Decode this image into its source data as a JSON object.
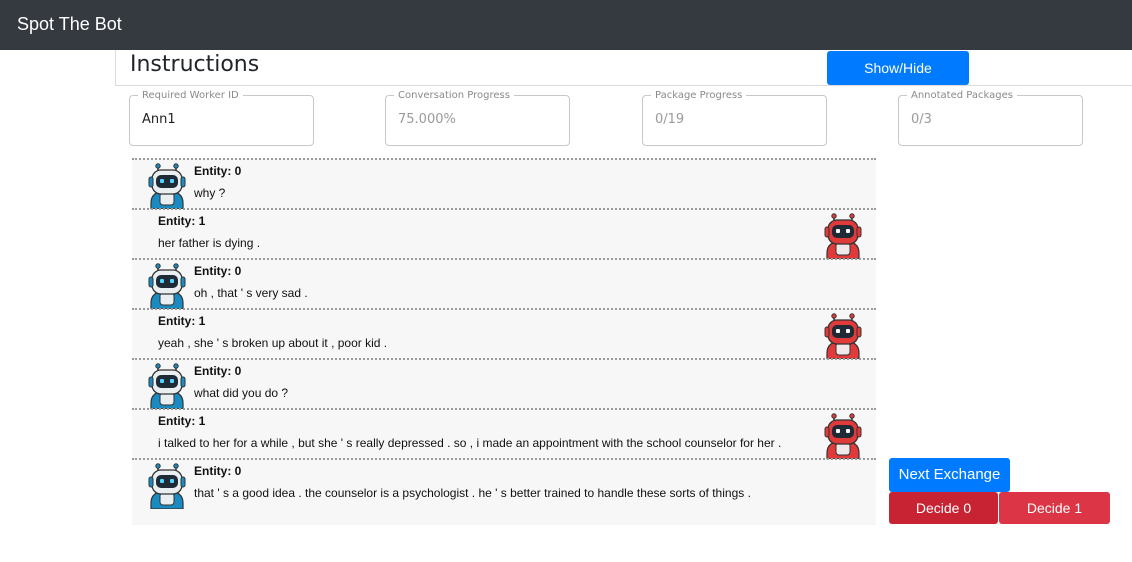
{
  "navbar": {
    "brand": "Spot The Bot"
  },
  "instructions": {
    "title": "Instructions",
    "toggle_label": "Show/Hide"
  },
  "fields": [
    {
      "label": "Required Worker ID",
      "value": "Ann1"
    },
    {
      "label": "Conversation Progress",
      "value": "75.000%"
    },
    {
      "label": "Package Progress",
      "value": "0/19"
    },
    {
      "label": "Annotated Packages",
      "value": "0/3"
    }
  ],
  "messages": [
    {
      "entity": "Entity: 0",
      "text": "why ?"
    },
    {
      "entity": "Entity: 1",
      "text": "her father is dying ."
    },
    {
      "entity": "Entity: 0",
      "text": "oh , that ' s very sad ."
    },
    {
      "entity": "Entity: 1",
      "text": "yeah , she ' s broken up about it , poor kid ."
    },
    {
      "entity": "Entity: 0",
      "text": "what did you do ?"
    },
    {
      "entity": "Entity: 1",
      "text": "i talked to her for a while , but she ' s really depressed . so , i made an appointment with the school counselor for her ."
    },
    {
      "entity": "Entity: 0",
      "text": "that ' s a good idea . the counselor is a psychologist . he ' s better trained to handle these sorts of things ."
    }
  ],
  "actions": {
    "next_label": "Next Exchange",
    "decide0_label": "Decide 0",
    "decide1_label": "Decide 1"
  },
  "icons": {
    "entity0_avatar": "blue-robot-icon",
    "entity1_avatar": "red-robot-icon"
  },
  "colors": {
    "navbar": "#343a40",
    "primary": "#007bff",
    "danger_dark": "#c82333",
    "danger": "#dc3545",
    "entity0": "#1a8bc0",
    "entity1": "#e03a3a"
  }
}
